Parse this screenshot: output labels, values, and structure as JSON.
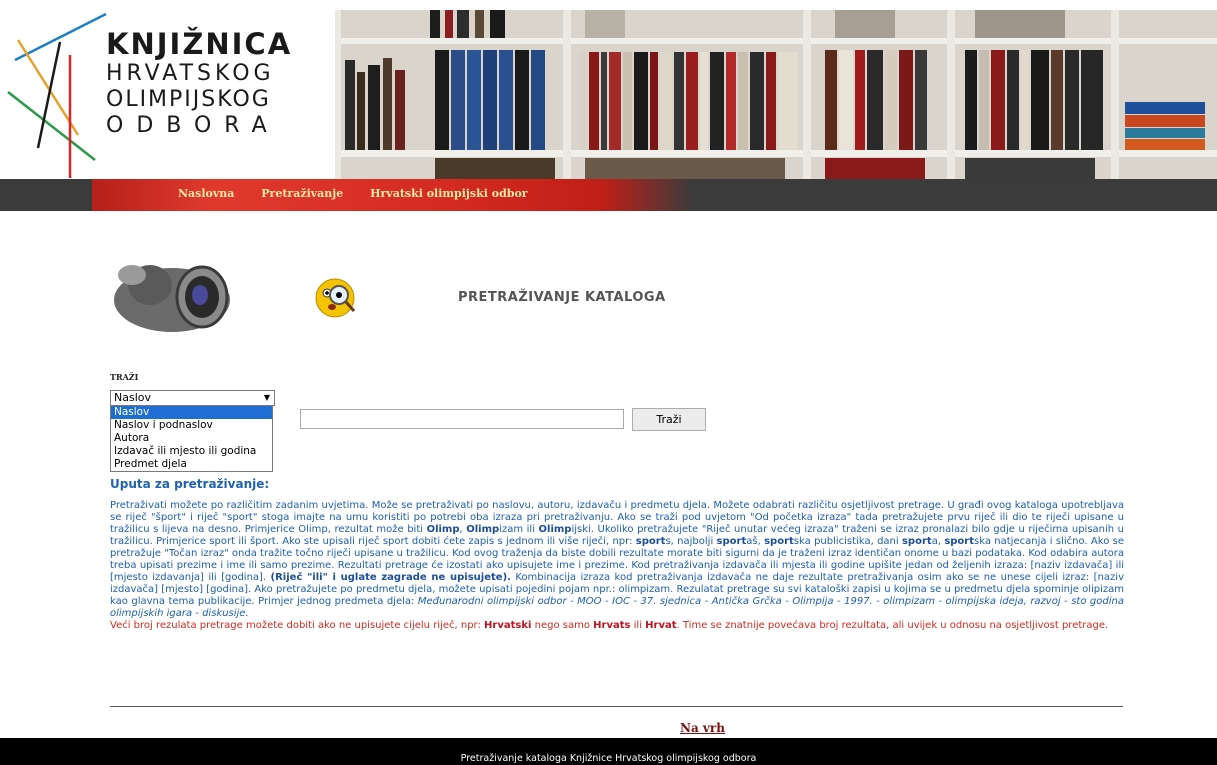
{
  "logo": {
    "line1": "KNJIŽNICA",
    "line2": "HRVATSKOG",
    "line3": "OLIMPIJSKOG",
    "line4": "ODBORA"
  },
  "nav": {
    "items": [
      "Naslovna",
      "Pretraživanje",
      "Hrvatski olimpijski odbor"
    ]
  },
  "main": {
    "title": "PRETRAŽIVANJE KATALOGA",
    "trazi_label": "TRAŽI",
    "select_value": "Naslov",
    "dropdown_options": [
      "Naslov",
      "Naslov i podnaslov",
      "Autora",
      "Izdavač ili mjesto ili godina",
      "Predmet djela"
    ],
    "search_value": "",
    "search_button": "Traži"
  },
  "help": {
    "title": "Uputa za pretraživanje:",
    "text_1": "Pretraživati možete po različitim zadanim uvjetima. Može se pretraživati po naslovu, autoru, izdavaču i predmetu djela. Možete odabrati različitu osjetljivost pretrage. U građi ovog kataloga upotrebljava se riječ \"šport\" i riječ \"sport\" stoga imajte na umu koristiti po potrebi oba izraza pri pretraživanju. Ako se traži pod uvjetom \"Od početka izraza\" tada pretražujete prvu riječ ili dio te riječi upisane u tražilicu s lijeva na desno. Primjerice Olimp, rezultat može biti ",
    "b_olimp": "Olimp",
    "t_comma": ", ",
    "b_olimp2": "Olimp",
    "t_izam": "izam ili ",
    "b_olimp3": "Olimp",
    "text_2": "ijski. Ukoliko pretražujete \"Riječ unutar većeg izraza\" traženi se izraz pronalazi bilo gdje u riječima upisanih u tražilicu. Primjerice sport ili šport. Ako ste upisali riječ sport dobiti ćete zapis s jednom ili više riječi, npr: ",
    "b_sport1": "sport",
    "t_s": "s, najbolji ",
    "b_sport2": "sport",
    "t_as": "aš, ",
    "b_sport3": "sport",
    "t_ska": "ska publicistika, dani ",
    "b_sport4": "sport",
    "t_a": "a, ",
    "b_sport5": "sport",
    "text_3": "ska natjecanja i slično. Ako se pretražuje \"Točan izraz\" onda tražite točno riječi upisane u tražilicu. Kod ovog traženja da biste dobili rezultate morate biti sigurni da je traženi izraz identičan onome u bazi podataka. Kod odabira autora treba upisati prezime i ime ili samo prezime. Rezultati pretrage će izostati ako upisujete ime i prezime. Kod pretraživanja izdavača ili mjesta ili godine upišite jedan od željenih izraza: [naziv izdavača] ili [mjesto izdavanja] ili [godina]. ",
    "b_rijec": "(Riječ \"ili\" i uglate zagrade ne upisujete).",
    "text_4": " Kombinacija izraza kod pretraživanja izdavača ne daje rezultate pretraživanja osim ako se ne unese cijeli izraz: [naziv izdavača] [mjesto] [godina]. Ako pretražujete po predmetu djela, možete upisati pojedini pojam npr.: olimpizam. Rezulatat pretrage su svi kataloški zapisi u kojima se u predmetu djela spominje olipizam kao glavna tema publikacije. Primjer jednog predmeta djela: ",
    "i_example": "Međunarodni olimpijski odbor - MOO - IOC - 37. sjednica - Antička Grčka - Olimpija - 1997. - olimpizam - olimpijska ideja, razvoj - sto godina olimpijskih igara - diskusije.",
    "tip_1": "Veći broj rezulata pretrage možete dobiti ako ne upisujete cijelu riječ, npr: ",
    "tip_b1": "Hrvatski",
    "tip_2": " nego samo ",
    "tip_b2": "Hrvats",
    "tip_3": " ili ",
    "tip_b3": "Hrvat",
    "tip_4": ". Time se znatnije povećava broj rezultata, ali uvijek u odnosu na osjetljivost pretrage."
  },
  "back_to_top": "Na vrh",
  "footer": "Pretraživanje kataloga Knjižnice Hrvatskog olimpijskog odbora",
  "colors": {
    "nav_red": "#d42a20",
    "nav_dark": "#3b3b3b",
    "help_blue": "#1e5fb0",
    "tip_red": "#d42a20"
  }
}
